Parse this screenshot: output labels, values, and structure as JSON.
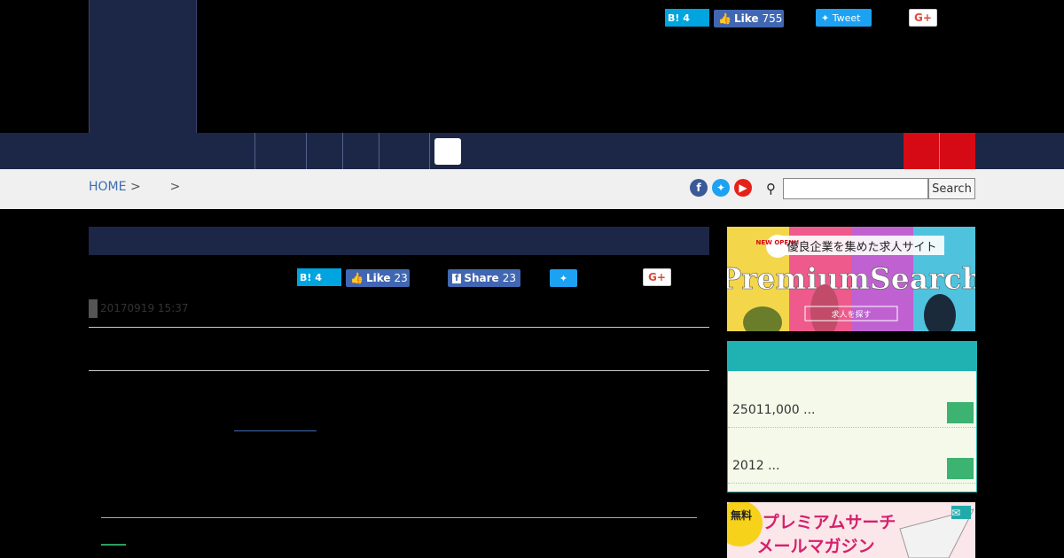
{
  "header": {
    "share": {
      "hatena_count": "4",
      "like_label": "Like",
      "like_count": "755",
      "tweet_label": "Tweet",
      "gplus_label": "G+"
    }
  },
  "breadcrumb": {
    "home": "HOME",
    "sep1": ">",
    "sep2": ">"
  },
  "search": {
    "button_label": "Search"
  },
  "article": {
    "share": {
      "hatena_count": "4",
      "like_label": "Like",
      "like_count": "23",
      "share_label": "Share",
      "share_count": "23",
      "gplus_label": "G+"
    },
    "date": "20170919 15:37"
  },
  "sidebar": {
    "ad1": {
      "new_badge": "NEW OPEN!!",
      "tagline": "優良企業を集めた求人サイト",
      "title": "PremiumSearch",
      "button": "求人を探す"
    },
    "widget_items": [
      {
        "text": "25011,000 ..."
      },
      {
        "text": "2012 ..."
      }
    ],
    "ad2": {
      "badge": "無料",
      "line1": "プレミアムサーチ",
      "line2": "メールマガジン"
    }
  },
  "colors": {
    "navy": "#1c2647",
    "red": "#d60a14",
    "teal": "#20b2b2",
    "green": "#3cb371",
    "link": "#3b6db1"
  }
}
